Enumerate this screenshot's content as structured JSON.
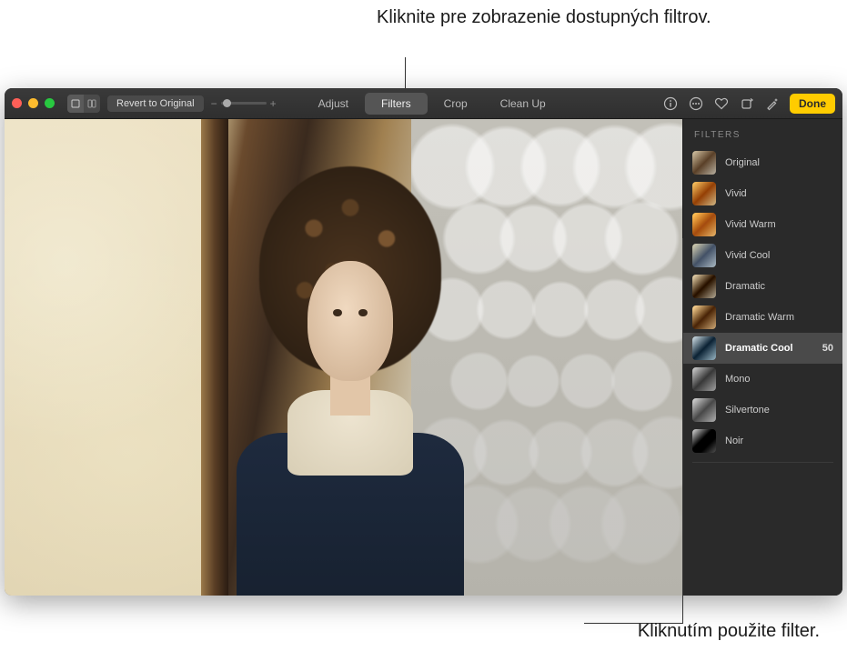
{
  "callouts": {
    "top": "Kliknite pre zobrazenie dostupných filtrov.",
    "bottom": "Kliknutím použite filter."
  },
  "toolbar": {
    "revert_label": "Revert to Original",
    "tabs": [
      {
        "id": "adjust",
        "label": "Adjust",
        "active": false
      },
      {
        "id": "filters",
        "label": "Filters",
        "active": true
      },
      {
        "id": "crop",
        "label": "Crop",
        "active": false
      },
      {
        "id": "cleanup",
        "label": "Clean Up",
        "active": false
      }
    ],
    "done_label": "Done"
  },
  "sidebar": {
    "title": "FILTERS",
    "filters": [
      {
        "id": "original",
        "label": "Original",
        "thumb": "ft-original",
        "selected": false
      },
      {
        "id": "vivid",
        "label": "Vivid",
        "thumb": "ft-vivid",
        "selected": false
      },
      {
        "id": "vividwarm",
        "label": "Vivid Warm",
        "thumb": "ft-vividwarm",
        "selected": false
      },
      {
        "id": "vividcool",
        "label": "Vivid Cool",
        "thumb": "ft-vividcool",
        "selected": false
      },
      {
        "id": "dramatic",
        "label": "Dramatic",
        "thumb": "ft-dramatic",
        "selected": false
      },
      {
        "id": "dramaticwarm",
        "label": "Dramatic Warm",
        "thumb": "ft-dramaticwarm",
        "selected": false
      },
      {
        "id": "dramaticcool",
        "label": "Dramatic Cool",
        "thumb": "ft-dramaticcool",
        "selected": true,
        "value": "50"
      },
      {
        "id": "mono",
        "label": "Mono",
        "thumb": "ft-mono",
        "selected": false
      },
      {
        "id": "silvertone",
        "label": "Silvertone",
        "thumb": "ft-silvertone",
        "selected": false
      },
      {
        "id": "noir",
        "label": "Noir",
        "thumb": "ft-noir",
        "selected": false
      }
    ]
  }
}
